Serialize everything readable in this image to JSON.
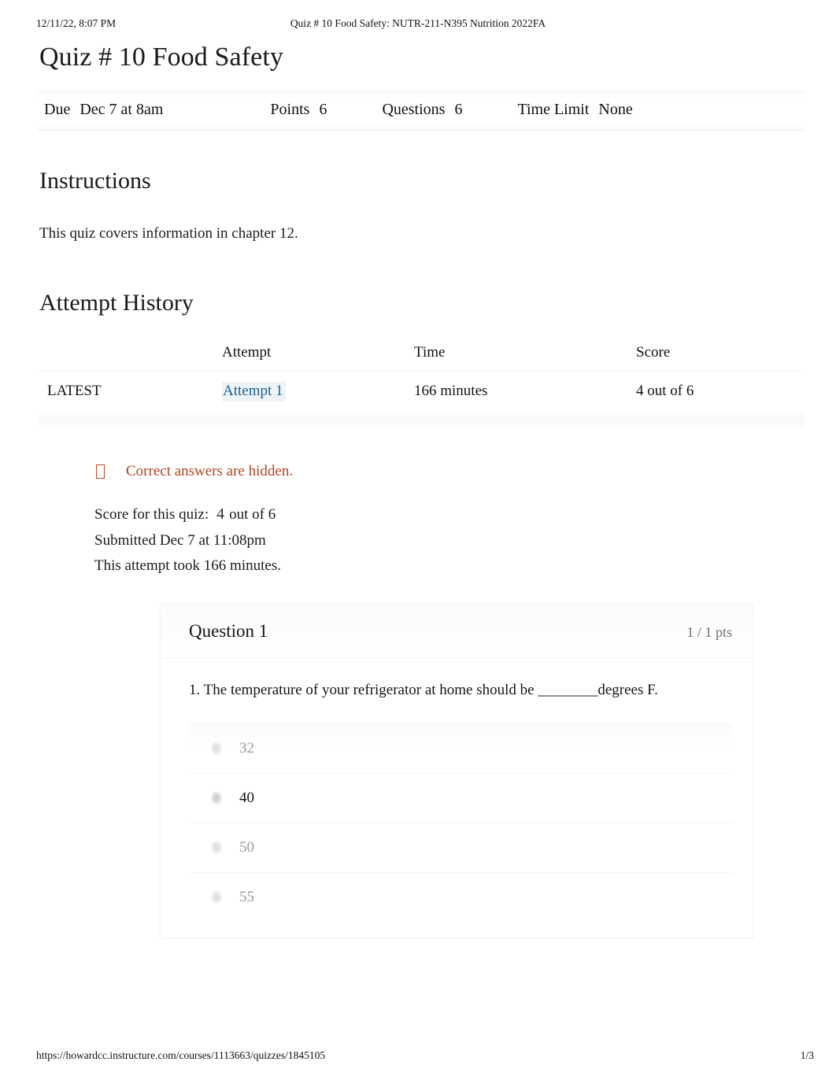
{
  "print_header": {
    "timestamp": "12/11/22, 8:07 PM",
    "document_title": "Quiz # 10 Food Safety: NUTR-211-N395 Nutrition 2022FA"
  },
  "quiz": {
    "title": "Quiz # 10 Food Safety",
    "meta": {
      "due_label": "Due",
      "due_value": "Dec 7 at 8am",
      "points_label": "Points",
      "points_value": "6",
      "questions_label": "Questions",
      "questions_value": "6",
      "time_limit_label": "Time Limit",
      "time_limit_value": "None"
    }
  },
  "instructions": {
    "heading": "Instructions",
    "body": "This quiz covers information in chapter 12."
  },
  "attempt_history": {
    "heading": "Attempt History",
    "columns": [
      "",
      "Attempt",
      "Time",
      "Score"
    ],
    "rows": [
      {
        "badge": "LATEST",
        "attempt": "Attempt 1",
        "time": "166 minutes",
        "score": "4 out of 6"
      }
    ]
  },
  "notice": {
    "icon": "hidden-answers-icon",
    "text": "Correct answers are hidden."
  },
  "summary": {
    "score_label": "Score for this quiz:",
    "score_value": "4",
    "score_suffix": "out of 6",
    "submitted": "Submitted Dec 7 at 11:08pm",
    "duration": "This attempt took 166 minutes."
  },
  "question": {
    "title": "Question 1",
    "points": "1 / 1 pts",
    "text": "1. The temperature of your refrigerator at home should be ________degrees F.",
    "answers": [
      {
        "label": "32",
        "selected": false
      },
      {
        "label": "40",
        "selected": true
      },
      {
        "label": "50",
        "selected": false
      },
      {
        "label": "55",
        "selected": false
      }
    ]
  },
  "print_footer": {
    "url": "https://howardcc.instructure.com/courses/1113663/quizzes/1845105",
    "page": "1/3"
  },
  "colors": {
    "link": "#1b6094",
    "notice": "#b5431f",
    "text": "#141414",
    "muted": "#9a9a9a"
  }
}
